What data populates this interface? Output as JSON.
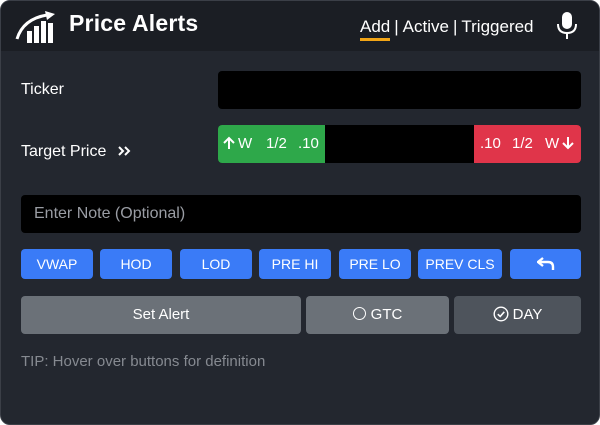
{
  "header": {
    "title": "Price Alerts",
    "tabs": [
      {
        "label": "Add",
        "active": true
      },
      {
        "label": "Active",
        "active": false
      },
      {
        "label": "Triggered",
        "active": false
      }
    ],
    "separator": "|",
    "logo_icon": "rising-bar-chart-logo-icon",
    "mic_icon": "microphone-icon"
  },
  "form": {
    "ticker_label": "Ticker",
    "ticker_value": "",
    "target_price_label": "Target Price",
    "target_price_icon": "double-chevron-right-icon",
    "target_price_value": "",
    "up_buttons": [
      {
        "label": "W",
        "icon": "arrow-up-icon"
      },
      {
        "label": "1/2"
      },
      {
        "label": ".10"
      }
    ],
    "down_buttons": [
      {
        "label": ".10"
      },
      {
        "label": "1/2"
      },
      {
        "label": "W",
        "icon": "arrow-down-icon"
      }
    ],
    "note_placeholder": "Enter Note (Optional)",
    "note_value": ""
  },
  "quick_buttons": [
    "VWAP",
    "HOD",
    "LOD",
    "PRE HI",
    "PRE LO",
    "PREV CLS"
  ],
  "undo_icon": "undo-arrow-icon",
  "actions": {
    "set_alert": "Set Alert",
    "gtc": "GTC",
    "day": "DAY",
    "gtc_selected": false,
    "day_selected": true
  },
  "tip": "TIP: Hover over buttons for definition",
  "colors": {
    "background": "#23272f",
    "header": "#1b1e24",
    "accent_tab_underline": "#f2a516",
    "up_green": "#2ea84a",
    "down_red": "#e0354a",
    "quick_blue": "#3a7bf7",
    "action_gray": "#6b7178"
  }
}
